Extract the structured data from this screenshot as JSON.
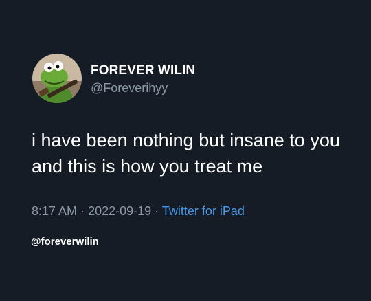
{
  "tweet": {
    "display_name": "FOREVER WILIN",
    "handle": "@Foreverihyy",
    "text": "i have been nothing but insane to you and this is how you treat me",
    "time": "8:17 AM",
    "separator": "·",
    "date": "2022-09-19",
    "source": "Twitter for iPad",
    "avatar_icon": "kermit-frog-avatar-icon"
  },
  "watermark": "@foreverwilin",
  "colors": {
    "background": "#151c26",
    "text": "#ffffff",
    "muted": "#8b98a5",
    "link": "#4a99e9"
  }
}
